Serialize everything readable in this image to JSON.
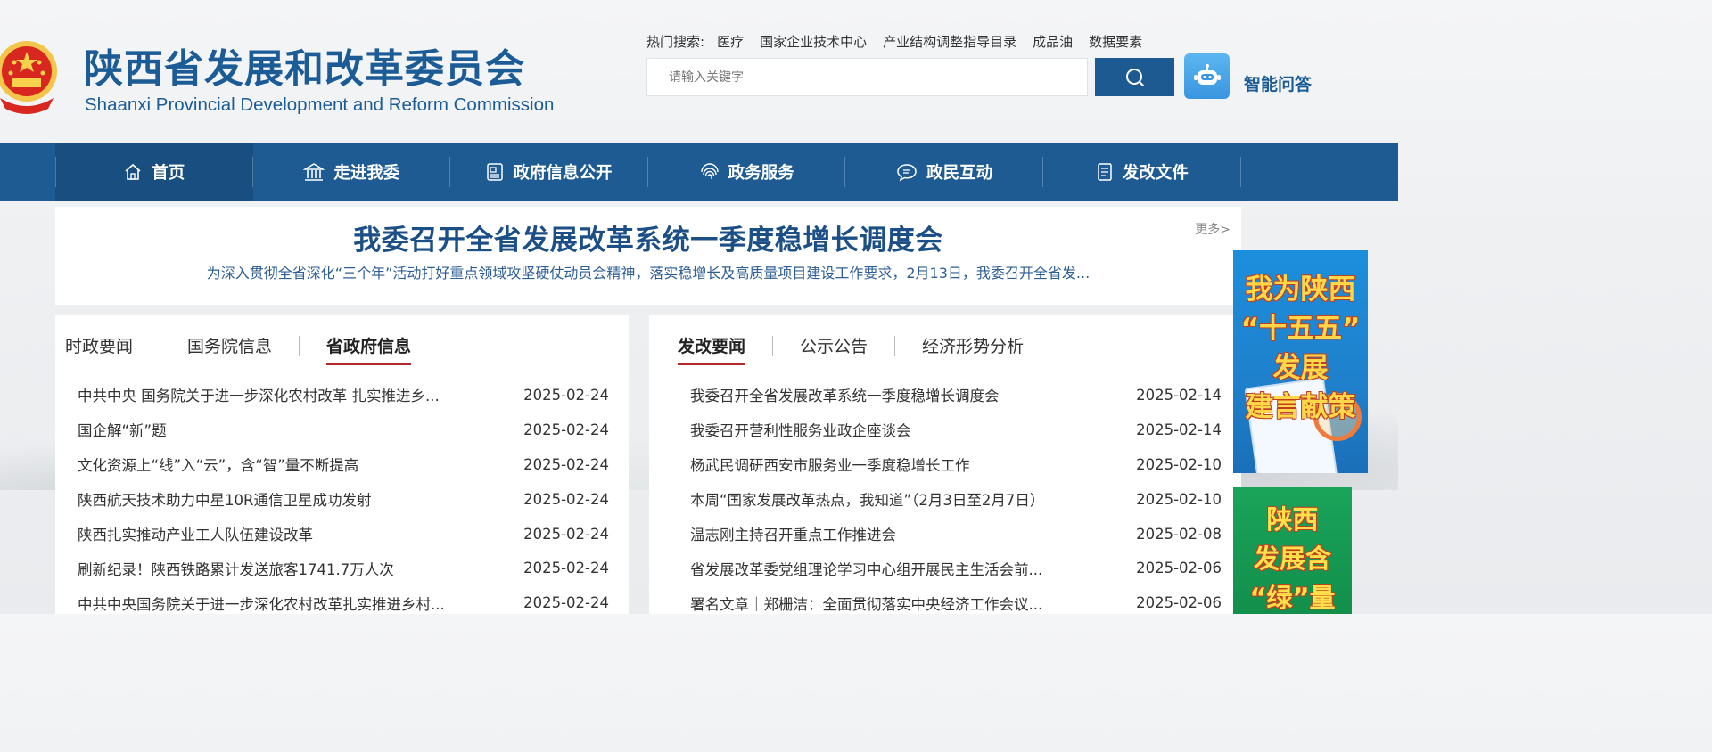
{
  "site": {
    "name_cn": "陕西省发展和改革委员会",
    "name_en": "Shaanxi Provincial Development and Reform Commission"
  },
  "hot_search": {
    "label": "热门搜索:",
    "items": [
      "医疗",
      "国家企业技术中心",
      "产业结构调整指导目录",
      "成品油",
      "数据要素"
    ]
  },
  "search": {
    "placeholder": "请输入关键字"
  },
  "ai": {
    "label": "智能问答"
  },
  "nav": {
    "items": [
      {
        "label": "首页",
        "icon": "home-icon"
      },
      {
        "label": "走进我委",
        "icon": "building-icon"
      },
      {
        "label": "政府信息公开",
        "icon": "info-icon"
      },
      {
        "label": "政务服务",
        "icon": "fingerprint-icon"
      },
      {
        "label": "政民互动",
        "icon": "chat-icon"
      },
      {
        "label": "发改文件",
        "icon": "document-icon"
      }
    ]
  },
  "headline": {
    "title": "我委召开全省发展改革系统一季度稳增长调度会",
    "summary": "为深入贯彻全省深化“三个年”活动打好重点领域攻坚硬仗动员会精神，落实稳增长及高质量项目建设工作要求，2月13日，我委召开全省发...",
    "more": "更多>"
  },
  "left_panel": {
    "tabs": [
      "时政要闻",
      "国务院信息",
      "省政府信息"
    ],
    "active_tab": 2,
    "news": [
      {
        "title": "中共中央 国务院关于进一步深化农村改革 扎实推进乡...",
        "date": "2025-02-24"
      },
      {
        "title": "国企解“新”题",
        "date": "2025-02-24"
      },
      {
        "title": "文化资源上“线”入“云”，含“智”量不断提高",
        "date": "2025-02-24"
      },
      {
        "title": "陕西航天技术助力中星10R通信卫星成功发射",
        "date": "2025-02-24"
      },
      {
        "title": "陕西扎实推动产业工人队伍建设改革",
        "date": "2025-02-24"
      },
      {
        "title": "刷新纪录！陕西铁路累计发送旅客1741.7万人次",
        "date": "2025-02-24"
      },
      {
        "title": "中共中央国务院关于进一步深化农村改革扎实推进乡村...",
        "date": "2025-02-24"
      }
    ]
  },
  "right_panel": {
    "tabs": [
      "发改要闻",
      "公示公告",
      "经济形势分析"
    ],
    "active_tab": 0,
    "news": [
      {
        "title": "我委召开全省发展改革系统一季度稳增长调度会",
        "date": "2025-02-14"
      },
      {
        "title": "我委召开营利性服务业政企座谈会",
        "date": "2025-02-14"
      },
      {
        "title": "杨武民调研西安市服务业一季度稳增长工作",
        "date": "2025-02-10"
      },
      {
        "title": "本周“国家发展改革热点，我知道”（2月3日至2月7日）",
        "date": "2025-02-10"
      },
      {
        "title": "温志刚主持召开重点工作推进会",
        "date": "2025-02-08"
      },
      {
        "title": "省发展改革委党组理论学习中心组开展民主生活会前...",
        "date": "2025-02-06"
      },
      {
        "title": "署名文章｜郑栅洁：全面贯彻落实中央经济工作会议...",
        "date": "2025-02-06"
      }
    ]
  },
  "banners": {
    "banner1": [
      "我为陕西",
      "“十五五”",
      "发展",
      "建言献策"
    ],
    "banner2": [
      "陕西",
      "发展含",
      "“绿”量"
    ]
  },
  "colors": {
    "brand": "#1e5b92",
    "nav_active": "#194f80",
    "tab_underline": "#b3282d",
    "headline": "#1b4f86"
  }
}
